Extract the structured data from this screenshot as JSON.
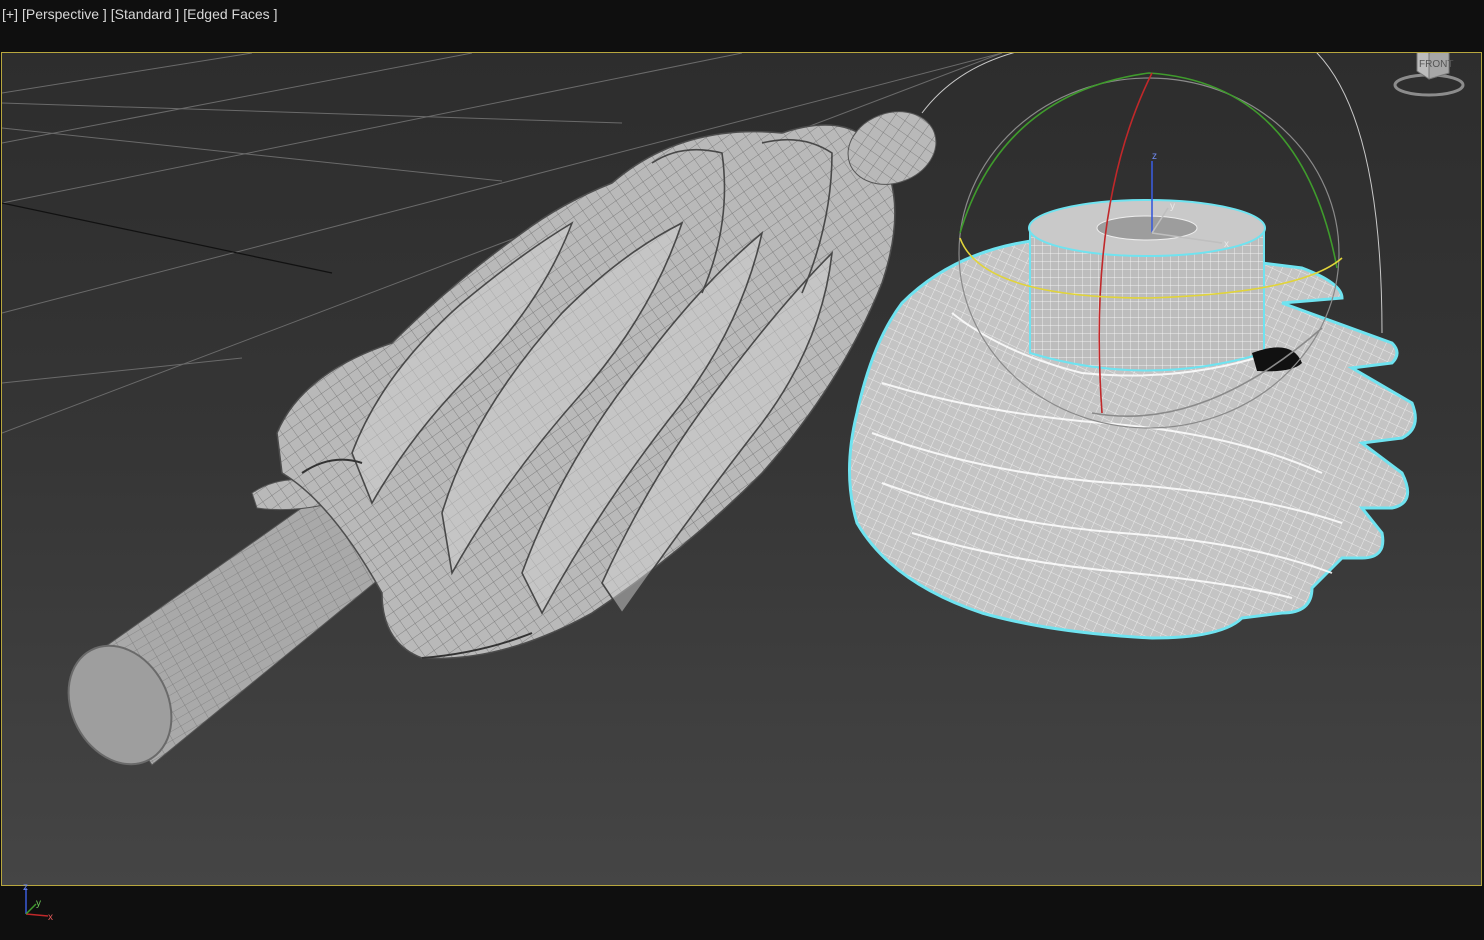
{
  "viewport_menu": {
    "plus": "[+]",
    "view": "[Perspective ]",
    "shading": "[Standard ]",
    "display": "[Edged Faces ]"
  },
  "viewcube": {
    "face_label": "FRONT"
  },
  "gizmo": {
    "axis_x": "x",
    "axis_y": "y",
    "axis_z": "z"
  },
  "tripod": {
    "axis_x": "x",
    "axis_y": "y",
    "axis_z": "z"
  },
  "colors": {
    "viewport_border": "#b7a63e",
    "selection_outline": "#6fe3f0",
    "gizmo_red": "#c0282a",
    "gizmo_green": "#3f9b2c",
    "gizmo_yellow": "#e1d43a",
    "gizmo_blue": "#3a5bd9"
  },
  "objects": [
    "pinion-gear-shaft",
    "ring-gear-selected"
  ]
}
